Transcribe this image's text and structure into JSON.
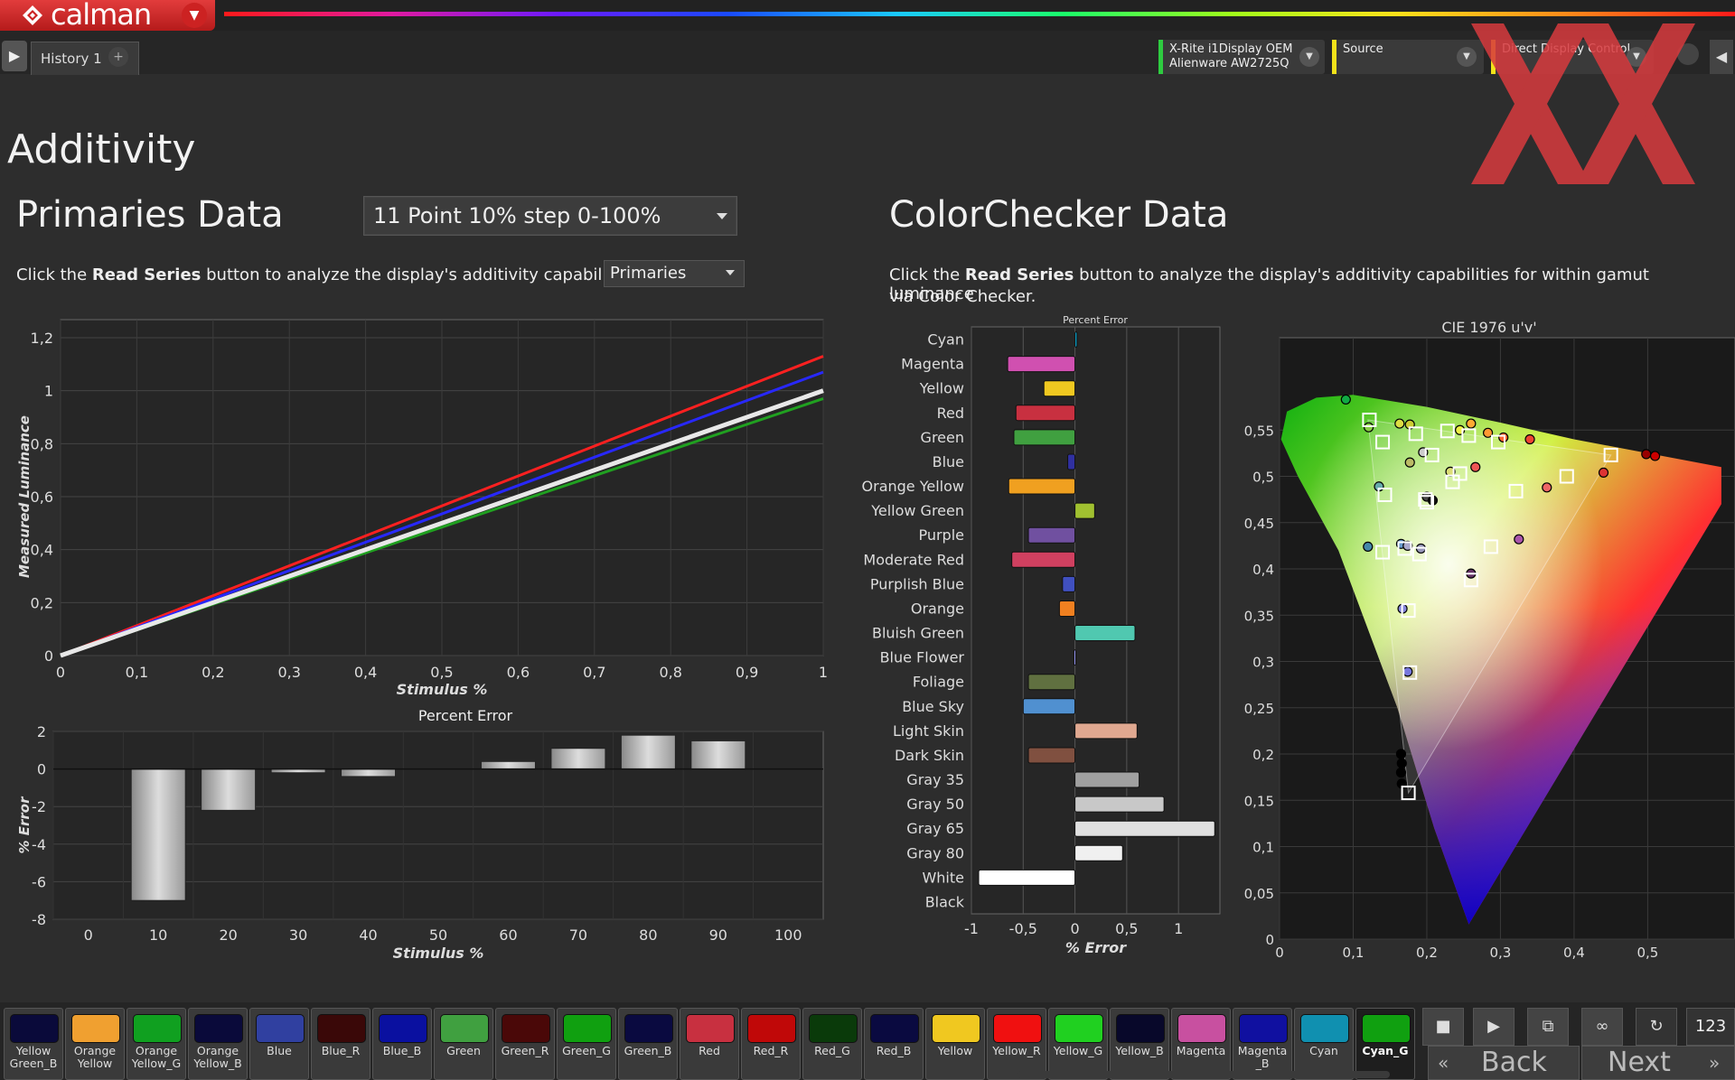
{
  "app": {
    "logo_text": "calman",
    "history_tab": "History 1",
    "history_add": "+",
    "devices": [
      {
        "line1": "X-Rite i1Display OEM",
        "line2": "Alienware AW2725Q",
        "color": "#2ecc40"
      },
      {
        "line1": "Source",
        "line2": "",
        "color": "#f2e21a"
      },
      {
        "line1": "Direct Display Control",
        "line2": "",
        "color": "#f2e21a"
      }
    ]
  },
  "page": {
    "title": "Additivity",
    "primaries_title": "Primaries Data",
    "series_select": "11 Point 10% step 0-100%",
    "primaries_desc_pre": "Click the ",
    "primaries_desc_bold": "Read Series",
    "primaries_desc_post": " button to analyze the display's additivity capabilities for",
    "type_select": "Primaries",
    "colorchecker_title": "ColorChecker Data",
    "cc_desc_pre": "Click the ",
    "cc_desc_bold": "Read Series",
    "cc_desc_post": " button to analyze the display's additivity capabilities for within gamut luminance",
    "cc_desc_line2": "via Color Checker."
  },
  "chart_data": [
    {
      "type": "line",
      "name": "luminance",
      "xlabel": "Stimulus %",
      "ylabel": "Measured Luminance",
      "xlim": [
        0,
        1
      ],
      "ylim": [
        0,
        1.2
      ],
      "xticks": [
        "0",
        "0,1",
        "0,2",
        "0,3",
        "0,4",
        "0,5",
        "0,6",
        "0,7",
        "0,8",
        "0,9",
        "1"
      ],
      "yticks": [
        "0",
        "0,2",
        "0,4",
        "0,6",
        "0,8",
        "1",
        "1,2"
      ],
      "series": [
        {
          "color": "#ff2020",
          "x": [
            0,
            1
          ],
          "y": [
            0,
            1.13
          ]
        },
        {
          "color": "#2828ff",
          "x": [
            0,
            1
          ],
          "y": [
            0,
            1.07
          ]
        },
        {
          "color": "#20a020",
          "x": [
            0,
            1
          ],
          "y": [
            0,
            0.97
          ]
        },
        {
          "color": "#e8e8e8",
          "x": [
            0,
            1
          ],
          "y": [
            0,
            1.0
          ]
        }
      ]
    },
    {
      "type": "bar",
      "name": "percent-error",
      "title": "Percent Error",
      "xlabel": "Stimulus %",
      "ylabel": "% Error",
      "ylim": [
        -8,
        2
      ],
      "yticks": [
        "2",
        "0",
        "-2",
        "-4",
        "-6",
        "-8"
      ],
      "categories": [
        "0",
        "10",
        "20",
        "30",
        "40",
        "50",
        "60",
        "70",
        "80",
        "90",
        "100"
      ],
      "values": [
        0,
        -7.0,
        -2.2,
        -0.2,
        -0.4,
        0,
        0.4,
        1.1,
        1.8,
        1.5,
        0
      ]
    },
    {
      "type": "bar",
      "name": "colorchecker-error",
      "title": "Percent Error",
      "xlabel": "% Error",
      "xlim": [
        -1,
        1.4
      ],
      "xticks": [
        "-1",
        "-0,5",
        "0",
        "0,5",
        "1"
      ],
      "categories": [
        "Cyan",
        "Magenta",
        "Yellow",
        "Red",
        "Green",
        "Blue",
        "Orange Yellow",
        "Yellow Green",
        "Purple",
        "Moderate Red",
        "Purplish Blue",
        "Orange",
        "Bluish Green",
        "Blue Flower",
        "Foliage",
        "Blue Sky",
        "Light Skin",
        "Dark Skin",
        "Gray 35",
        "Gray 50",
        "Gray 65",
        "Gray 80",
        "White",
        "Black"
      ],
      "values": [
        0.02,
        -0.65,
        -0.3,
        -0.57,
        -0.59,
        -0.07,
        -0.64,
        0.19,
        -0.45,
        -0.61,
        -0.12,
        -0.15,
        0.58,
        -0.01,
        -0.45,
        -0.5,
        0.6,
        -0.45,
        0.62,
        0.86,
        1.35,
        0.46,
        -0.93,
        0
      ],
      "colors": [
        "#0aa0c8",
        "#d050b0",
        "#f0c820",
        "#c83040",
        "#40a040",
        "#3030a0",
        "#f0a020",
        "#a0c030",
        "#7050a0",
        "#d04060",
        "#4050c0",
        "#f08020",
        "#50c8b0",
        "#a0a0ff",
        "#607040",
        "#5090d0",
        "#e0a890",
        "#805040",
        "#a0a0a0",
        "#c8c8c8",
        "#e0e0e0",
        "#f0f0f0",
        "#ffffff",
        "#202020"
      ]
    },
    {
      "type": "scatter",
      "name": "cie-1976",
      "title": "CIE 1976 u'v'",
      "xlim": [
        0,
        0.6
      ],
      "ylim": [
        0,
        0.6
      ],
      "xticks": [
        "0",
        "0,1",
        "0,2",
        "0,3",
        "0,4",
        "0,5"
      ],
      "yticks": [
        "0",
        "0,05",
        "0,1",
        "0,15",
        "0,2",
        "0,25",
        "0,3",
        "0,35",
        "0,4",
        "0,45",
        "0,5",
        "0,55"
      ],
      "gamut_triangle": [
        [
          0.45,
          0.523
        ],
        [
          0.12,
          0.561
        ],
        [
          0.175,
          0.158
        ]
      ],
      "targets": [
        [
          0.45,
          0.523
        ],
        [
          0.122,
          0.561
        ],
        [
          0.175,
          0.158
        ],
        [
          0.14,
          0.537
        ],
        [
          0.185,
          0.546
        ],
        [
          0.228,
          0.549
        ],
        [
          0.257,
          0.544
        ],
        [
          0.297,
          0.537
        ],
        [
          0.207,
          0.523
        ],
        [
          0.245,
          0.503
        ],
        [
          0.235,
          0.494
        ],
        [
          0.39,
          0.5
        ],
        [
          0.321,
          0.484
        ],
        [
          0.143,
          0.48
        ],
        [
          0.198,
          0.475
        ],
        [
          0.2,
          0.472
        ],
        [
          0.14,
          0.418
        ],
        [
          0.17,
          0.422
        ],
        [
          0.19,
          0.416
        ],
        [
          0.287,
          0.424
        ],
        [
          0.26,
          0.388
        ],
        [
          0.175,
          0.355
        ],
        [
          0.177,
          0.288
        ]
      ],
      "measured": [
        [
          0.09,
          0.583
        ],
        [
          0.121,
          0.553
        ],
        [
          0.163,
          0.557
        ],
        [
          0.177,
          0.556
        ],
        [
          0.245,
          0.55
        ],
        [
          0.26,
          0.557
        ],
        [
          0.283,
          0.547
        ],
        [
          0.304,
          0.542
        ],
        [
          0.34,
          0.54
        ],
        [
          0.195,
          0.526
        ],
        [
          0.177,
          0.515
        ],
        [
          0.232,
          0.505
        ],
        [
          0.266,
          0.51
        ],
        [
          0.363,
          0.488
        ],
        [
          0.44,
          0.504
        ],
        [
          0.498,
          0.524
        ],
        [
          0.51,
          0.522
        ],
        [
          0.135,
          0.489
        ],
        [
          0.2,
          0.478
        ],
        [
          0.208,
          0.474
        ],
        [
          0.12,
          0.424
        ],
        [
          0.165,
          0.427
        ],
        [
          0.174,
          0.425
        ],
        [
          0.192,
          0.422
        ],
        [
          0.325,
          0.432
        ],
        [
          0.26,
          0.395
        ],
        [
          0.167,
          0.357
        ],
        [
          0.174,
          0.289
        ],
        [
          0.165,
          0.2
        ],
        [
          0.166,
          0.19
        ],
        [
          0.165,
          0.18
        ],
        [
          0.166,
          0.168
        ]
      ],
      "measured_colors": [
        "#1a4",
        "#8c4",
        "#dd4",
        "#cc3",
        "#ee4",
        "#fa3",
        "#f93",
        "#f63",
        "#e43",
        "#ccc",
        "#bb6",
        "#dd7",
        "#e55",
        "#e66",
        "#d33",
        "#900",
        "#c00",
        "#6aa",
        "#444",
        "#111",
        "#48a",
        "#69c",
        "#aac",
        "#99b",
        "#a5a",
        "#636",
        "#88d",
        "#77d",
        "#000",
        "#000",
        "#000",
        "#000"
      ]
    }
  ],
  "patches": [
    {
      "label": "Yellow Green_B",
      "color": "#0a0a3a"
    },
    {
      "label": "Orange Yellow",
      "color": "#f0a030"
    },
    {
      "label": "Orange Yellow_G",
      "color": "#10a020"
    },
    {
      "label": "Orange Yellow_B",
      "color": "#0a0a3a"
    },
    {
      "label": "Blue",
      "color": "#3040a0"
    },
    {
      "label": "Blue_R",
      "color": "#3a0808"
    },
    {
      "label": "Blue_B",
      "color": "#0a10a0"
    },
    {
      "label": "Green",
      "color": "#40a040"
    },
    {
      "label": "Green_R",
      "color": "#4a0808"
    },
    {
      "label": "Green_G",
      "color": "#10a010"
    },
    {
      "label": "Green_B",
      "color": "#0a0a40"
    },
    {
      "label": "Red",
      "color": "#c83040"
    },
    {
      "label": "Red_R",
      "color": "#c00808"
    },
    {
      "label": "Red_G",
      "color": "#0a3a0a"
    },
    {
      "label": "Red_B",
      "color": "#0a0a40"
    },
    {
      "label": "Yellow",
      "color": "#f0c820"
    },
    {
      "label": "Yellow_R",
      "color": "#f01010"
    },
    {
      "label": "Yellow_G",
      "color": "#20d020"
    },
    {
      "label": "Yellow_B",
      "color": "#08082a"
    },
    {
      "label": "Magenta",
      "color": "#c850a0"
    },
    {
      "label": "Magenta _B",
      "color": "#1010a0"
    },
    {
      "label": "Cyan",
      "color": "#1090b0"
    },
    {
      "label": "Cyan_G",
      "color": "#10a010"
    }
  ],
  "controls": {
    "counter": "123",
    "back": "Back",
    "next": "Next"
  }
}
